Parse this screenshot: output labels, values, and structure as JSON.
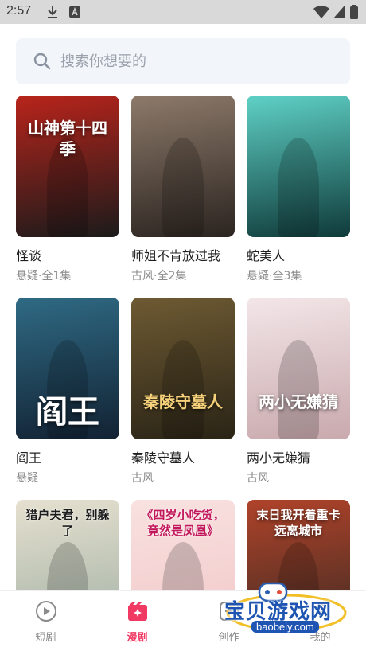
{
  "status": {
    "time": "2:57",
    "icons": [
      "download-icon",
      "a-badge-icon",
      "wifi-icon",
      "signal-icon",
      "battery-icon"
    ]
  },
  "search": {
    "placeholder": "搜索你想要的",
    "icon": "search-icon"
  },
  "items": [
    {
      "title": "怪谈",
      "meta": "悬疑·全1集",
      "cover_text": "山神第十四季",
      "palette": [
        "#1b1b1b",
        "#b8241b"
      ]
    },
    {
      "title": "师姐不肯放过我",
      "meta": "古风·全2集",
      "cover_text": "",
      "palette": [
        "#2b2420",
        "#8d7a6a"
      ]
    },
    {
      "title": "蛇美人",
      "meta": "悬疑·全3集",
      "cover_text": "",
      "palette": [
        "#0f3a3a",
        "#5fd1c6"
      ]
    },
    {
      "title": "阎王",
      "meta": "悬疑",
      "cover_text": "阎王",
      "palette": [
        "#122233",
        "#2f6a84"
      ]
    },
    {
      "title": "秦陵守墓人",
      "meta": "古风",
      "cover_text": "秦陵守墓人",
      "palette": [
        "#2a2416",
        "#6e5a33"
      ]
    },
    {
      "title": "两小无嫌猜",
      "meta": "古风",
      "cover_text": "两小无嫌猜",
      "palette": [
        "#c9a9ad",
        "#f3e6e8"
      ]
    },
    {
      "title": "",
      "meta": "",
      "cover_text": "猎户夫君，别躲了",
      "palette": [
        "#9fb0a4",
        "#e6e0cf"
      ]
    },
    {
      "title": "",
      "meta": "",
      "cover_text": "《四岁小吃货，竟然是凤凰》",
      "palette": [
        "#f2c6c8",
        "#f8e2e0"
      ]
    },
    {
      "title": "",
      "meta": "",
      "cover_text": "末日我开着重卡远离城市",
      "palette": [
        "#3b2a22",
        "#b0432a"
      ]
    }
  ],
  "tabs": [
    {
      "label": "短剧",
      "icon": "play-circle-icon"
    },
    {
      "label": "漫剧",
      "icon": "sparkle-clapper-icon"
    },
    {
      "label": "创作",
      "icon": "create-icon"
    },
    {
      "label": "我的",
      "icon": "profile-icon"
    }
  ],
  "active_tab": "漫剧",
  "watermark": {
    "line1": "宝贝游戏网",
    "line2": "baobeiy.com"
  },
  "colors": {
    "accent": "#f03a64",
    "search_bg": "#f2f5fa",
    "statusbar": "#d9d9d9"
  }
}
